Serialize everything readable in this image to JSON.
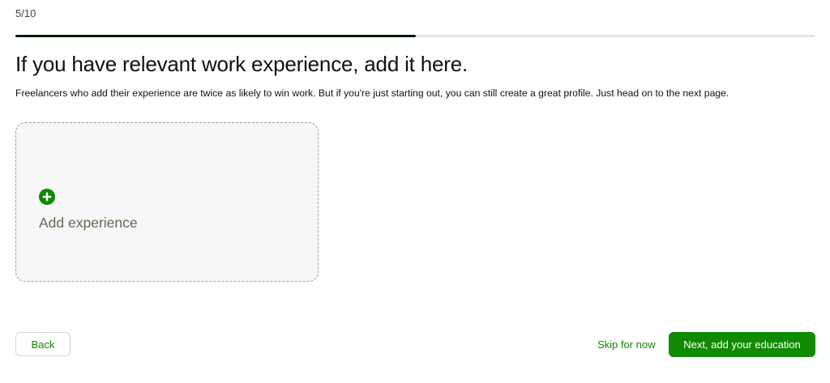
{
  "progress": {
    "step_text": "5/10",
    "fraction": 0.5
  },
  "header": {
    "title": "If you have relevant work experience, add it here.",
    "subtitle": "Freelancers who add their experience are twice as likely to win work. But if you're just starting out, you can still create a great profile. Just head on to the next page."
  },
  "add_card": {
    "label": "Add experience",
    "icon": "plus-circle-icon"
  },
  "footer": {
    "back_label": "Back",
    "skip_label": "Skip for now",
    "next_label": "Next, add your education"
  },
  "colors": {
    "accent": "#108a00",
    "progress_fill": "#001e00",
    "progress_track": "#e6e6e6"
  }
}
